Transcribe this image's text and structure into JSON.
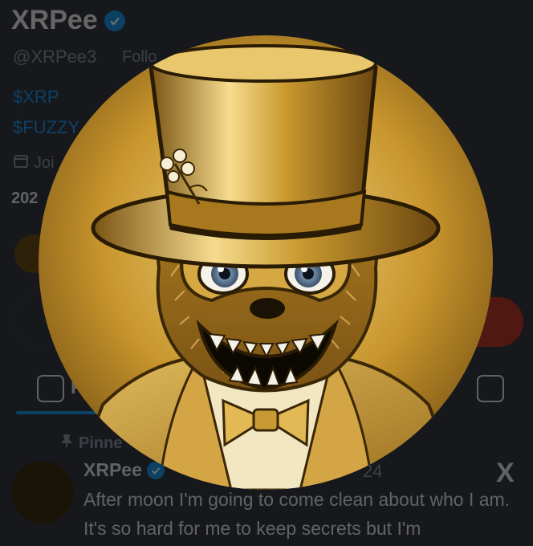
{
  "profile": {
    "name": "XRPee",
    "handle": "@XRPee3",
    "follows_label": "Follo",
    "bio_lines": [
      "$XRP",
      "$FUZZY"
    ],
    "joined_label": "Joi",
    "stats_fragment": "202"
  },
  "tabs": {
    "first_label": "F"
  },
  "pinned_post": {
    "pinned_label": "Pinne",
    "author": "XRPee",
    "date_fragment": "24",
    "text": "After moon I'm going to come clean about who I am. It's so hard for me to keep secrets but I'm"
  },
  "colors": {
    "accent": "#1d9bf0",
    "background": "#16181c",
    "gold": "#c89a2e"
  },
  "icons": [
    "verified-badge-icon",
    "calendar-icon",
    "pin-icon",
    "x-logo-icon",
    "posts-tab-icon",
    "video-tab-icon"
  ]
}
